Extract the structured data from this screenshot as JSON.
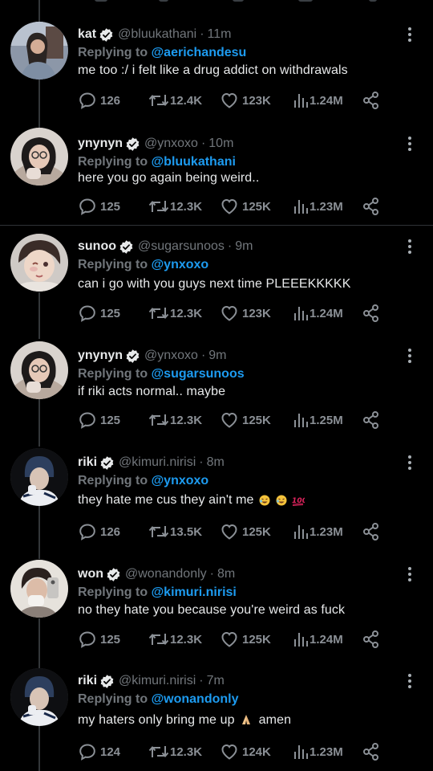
{
  "tweets": [
    {
      "name": "kat",
      "handle": "@bluukathani",
      "time": "11m",
      "replying_prefix": "Replying to ",
      "replying_to": "@aerichandesu",
      "text": "me too :/ i felt like a drug addict on withdrawals",
      "replies": "126",
      "retweets": "12.4K",
      "likes": "123K",
      "views": "1.24M"
    },
    {
      "name": "ynynyn",
      "handle": "@ynxoxo",
      "time": "10m",
      "replying_prefix": "Replying to ",
      "replying_to": "@bluukathani",
      "text": "here you go again being weird..",
      "replies": "125",
      "retweets": "12.3K",
      "likes": "125K",
      "views": "1.23M"
    },
    {
      "name": "sunoo",
      "handle": "@sugarsunoos",
      "time": "9m",
      "replying_prefix": "Replying to ",
      "replying_to": "@ynxoxo",
      "text": "can i go with you guys next time PLEEEKKKKK",
      "replies": "125",
      "retweets": "12.3K",
      "likes": "123K",
      "views": "1.24M"
    },
    {
      "name": "ynynyn",
      "handle": "@ynxoxo",
      "time": "9m",
      "replying_prefix": "Replying to ",
      "replying_to": "@sugarsunoos",
      "text": "if riki acts normal.. maybe",
      "replies": "125",
      "retweets": "12.3K",
      "likes": "125K",
      "views": "1.25M"
    },
    {
      "name": "riki",
      "handle": "@kimuri.nirisi",
      "time": "8m",
      "replying_prefix": "Replying to ",
      "replying_to": "@ynxoxo",
      "text": "they hate me cus they ain't me",
      "replies": "126",
      "retweets": "13.5K",
      "likes": "125K",
      "views": "1.23M"
    },
    {
      "name": "won",
      "handle": "@wonandonly",
      "time": "8m",
      "replying_prefix": "Replying to ",
      "replying_to": "@kimuri.nirisi",
      "text": "no they hate you because you're weird as fuck",
      "replies": "125",
      "retweets": "12.3K",
      "likes": "125K",
      "views": "1.24M"
    },
    {
      "name": "riki",
      "handle": "@kimuri.nirisi",
      "time": "7m",
      "replying_prefix": "Replying to ",
      "replying_to": "@wonandonly",
      "text": "my haters only bring me up",
      "text_after": "amen",
      "replies": "124",
      "retweets": "12.3K",
      "likes": "124K",
      "views": "1.23M"
    }
  ],
  "icons": {
    "reply": "speech-bubble-icon",
    "retweet": "retweet-arrows-icon",
    "like": "heart-outline-icon",
    "views": "bar-chart-icon",
    "share": "share-nodes-icon",
    "verified": "verified-badge-icon",
    "more": "vertical-dots-icon"
  },
  "colors": {
    "background": "#000000",
    "text": "#e7e9ea",
    "muted": "#71767b",
    "link": "#1d9bf0",
    "divider": "#2f3336"
  }
}
